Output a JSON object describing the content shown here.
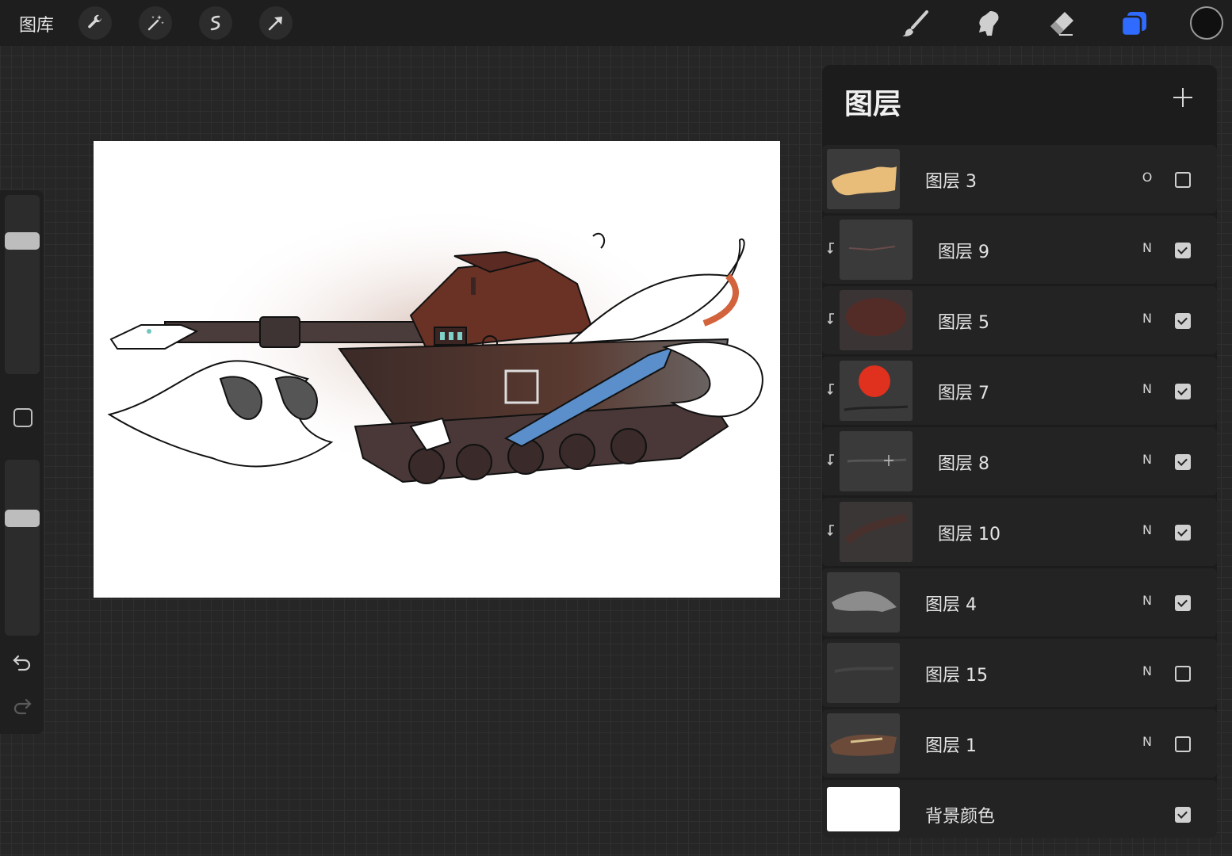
{
  "app": {
    "gallery_label": "图库",
    "tools_left": [
      "wrench-icon",
      "magic-wand-icon",
      "selection-icon",
      "transform-arrow-icon"
    ],
    "tools_right": [
      "brush-icon",
      "smudge-icon",
      "eraser-icon",
      "layers-icon"
    ],
    "accent_color": "#2f6bff",
    "current_color": "#101010"
  },
  "layers_panel": {
    "title": "图层",
    "layers": [
      {
        "name": "图层 3",
        "blend": "O",
        "visible": false,
        "clipped": false
      },
      {
        "name": "图层 9",
        "blend": "N",
        "visible": true,
        "clipped": true
      },
      {
        "name": "图层 5",
        "blend": "N",
        "visible": true,
        "clipped": true
      },
      {
        "name": "图层 7",
        "blend": "N",
        "visible": true,
        "clipped": true
      },
      {
        "name": "图层 8",
        "blend": "N",
        "visible": true,
        "clipped": true
      },
      {
        "name": "图层 10",
        "blend": "N",
        "visible": true,
        "clipped": true
      },
      {
        "name": "图层 4",
        "blend": "N",
        "visible": true,
        "clipped": false
      },
      {
        "name": "图层 15",
        "blend": "N",
        "visible": false,
        "clipped": false
      },
      {
        "name": "图层 1",
        "blend": "N",
        "visible": false,
        "clipped": false
      },
      {
        "name": "背景颜色",
        "blend": "",
        "visible": true,
        "clipped": false
      }
    ]
  }
}
